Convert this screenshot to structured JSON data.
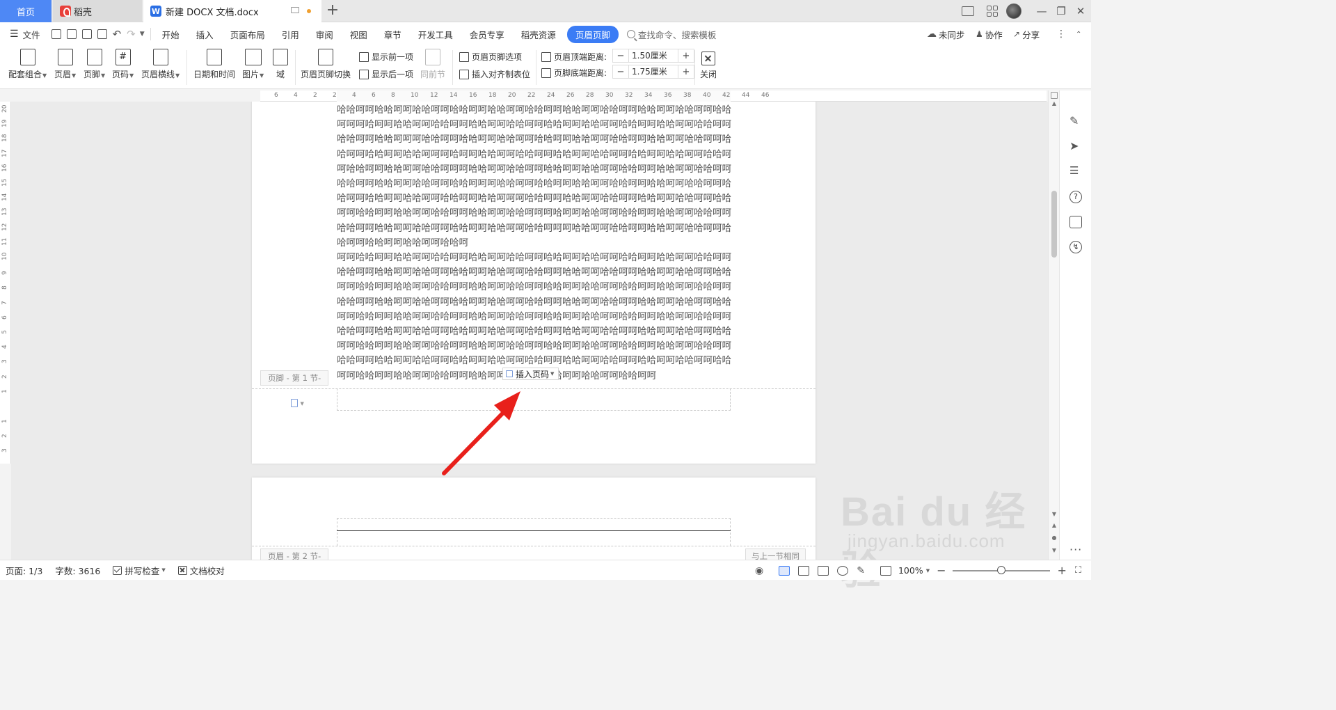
{
  "tabs": {
    "home": "首页",
    "docer": "稻壳",
    "document": "新建 DOCX 文档.docx",
    "w_letter": "W"
  },
  "menu": {
    "file": "文件",
    "items": [
      "开始",
      "插入",
      "页面布局",
      "引用",
      "审阅",
      "视图",
      "章节",
      "开发工具",
      "会员专享",
      "稻壳资源"
    ],
    "active": "页眉页脚",
    "search": "查找命令、搜索模板",
    "sync": "未同步",
    "collab": "协作",
    "share": "分享"
  },
  "ribbon": {
    "set": "配套组合",
    "header": "页眉",
    "footer": "页脚",
    "page_number": "页码",
    "header_line": "页眉横线",
    "datetime": "日期和时间",
    "picture": "图片",
    "field": "域",
    "switch": "页眉页脚切换",
    "show_prev": "显示前一项",
    "show_next": "显示后一项",
    "same_as_prev": "同前节",
    "options": "页眉页脚选项",
    "insert_align_tab": "插入对齐制表位",
    "header_top_label": "页眉顶端距离:",
    "header_top_value": "1.50厘米",
    "footer_bottom_label": "页脚底端距离:",
    "footer_bottom_value": "1.75厘米",
    "minus": "−",
    "plus": "+",
    "close": "关闭",
    "hash": "#"
  },
  "ruler": {
    "h": [
      "6",
      "4",
      "2",
      "2",
      "4",
      "6",
      "8",
      "10",
      "12",
      "14",
      "16",
      "18",
      "20",
      "22",
      "24",
      "26",
      "28",
      "30",
      "32",
      "34",
      "36",
      "38",
      "40",
      "42",
      "44",
      "46"
    ],
    "v_top": [
      "20",
      "19",
      "18",
      "17",
      "16",
      "15",
      "14",
      "13",
      "12",
      "11",
      "10",
      "9",
      "8",
      "7",
      "6",
      "5",
      "4",
      "3",
      "2",
      "1"
    ],
    "v_bottom": [
      "1",
      "2",
      "3"
    ]
  },
  "document": {
    "para1": "哈哈呵呵哈哈呵呵哈哈呵呵哈哈呵呵哈哈呵呵哈哈呵呵哈哈呵呵哈哈呵呵哈哈呵呵哈哈呵呵哈哈呵呵呵哈呵呵哈哈呵呵哈哈呵呵哈哈呵呵哈哈呵呵哈哈呵呵哈哈呵呵哈哈呵呵哈哈呵呵哈哈呵呵哈哈呵呵哈哈呵呵呵哈哈呵呵哈哈呵呵哈哈呵呵哈哈呵呵哈哈呵呵哈哈呵呵哈哈呵呵哈哈呵呵哈哈呵呵哈哈呵呵哈哈呵呵呵哈呵呵哈哈呵呵哈哈呵呵哈哈呵呵哈哈呵呵哈哈呵呵哈哈呵呵哈哈呵呵哈哈呵呵哈哈呵呵哈哈呵呵呵哈哈呵呵哈哈呵呵哈哈呵呵哈哈呵呵哈哈呵呵哈哈呵呵哈哈呵呵哈哈呵呵哈哈呵呵哈哈呵呵哈哈呵呵呵哈哈呵呵哈哈呵呵哈哈呵呵哈哈呵呵哈哈呵呵哈哈呵呵哈哈呵呵哈哈呵呵哈哈呵呵哈哈呵呵哈哈呵呵呵哈哈呵呵哈哈呵呵哈哈呵呵哈哈呵呵哈哈呵呵哈哈呵呵哈哈呵呵哈哈呵呵哈哈呵呵哈哈呵呵哈哈呵呵呵哈呵呵哈哈呵呵哈哈呵呵哈哈呵呵哈哈呵呵哈哈呵呵哈哈呵呵哈哈呵呵哈哈呵呵哈哈呵呵哈哈呵呵呵哈哈呵呵哈哈呵呵哈哈呵呵哈哈呵呵哈哈呵呵哈哈呵呵哈哈呵呵哈哈呵",
    "para2": "呵呵哈哈呵呵哈哈呵呵哈哈呵呵哈哈呵呵哈哈呵呵哈哈呵呵哈哈呵呵哈哈呵呵哈哈呵呵哈哈呵呵哈哈呵呵哈哈呵呵哈哈呵呵哈哈呵呵哈哈呵呵哈哈呵呵哈哈呵呵哈哈呵呵哈哈呵呵哈哈呵呵哈哈呵呵哈哈呵呵哈哈呵呵哈哈呵呵哈哈呵呵哈哈呵呵哈哈呵呵哈哈呵呵哈哈呵呵哈哈呵呵哈哈呵呵哈哈呵呵哈哈呵呵哈哈呵呵哈哈呵呵哈哈呵呵哈哈呵呵哈哈呵呵哈哈呵呵哈哈呵呵哈哈呵呵哈哈呵呵哈哈呵呵哈哈呵呵哈哈呵呵哈哈呵呵哈哈呵呵哈哈呵呵哈哈呵呵哈哈呵呵哈哈呵呵哈哈呵呵哈哈呵呵哈哈呵呵哈哈呵呵哈哈呵呵哈哈呵呵哈哈呵呵哈哈呵呵哈哈呵呵哈哈呵呵哈哈呵呵哈哈呵呵哈哈呵呵哈哈呵呵哈哈呵呵哈哈呵呵哈哈呵呵哈哈呵呵哈哈呵呵哈哈呵呵哈哈呵呵哈哈呵呵哈哈呵呵哈哈呵呵哈哈呵呵哈哈呵呵哈哈呵呵哈哈呵呵哈哈呵呵哈哈呵呵哈哈呵呵哈哈呵呵哈哈呵呵哈哈呵呵哈哈呵呵哈哈呵呵哈哈呵呵哈哈呵呵哈哈呵呵哈哈呵呵哈哈呵呵",
    "footer_label": "页脚 - 第 1 节-",
    "insert_page_number": "插入页码",
    "header_label": "页眉 - 第 2 节-",
    "same_as_previous": "与上一节相同"
  },
  "watermark": {
    "brand": "Bai du 经验",
    "url": "jingyan.baidu.com"
  },
  "status": {
    "page": "页面: 1/3",
    "words": "字数: 3616",
    "spell": "拼写检查",
    "proof": "文档校对",
    "zoom": "100%",
    "zoom_slider_fraction": 0.5
  },
  "colors": {
    "accent": "#3b7cf5",
    "annotation_arrow": "#e8201b"
  }
}
